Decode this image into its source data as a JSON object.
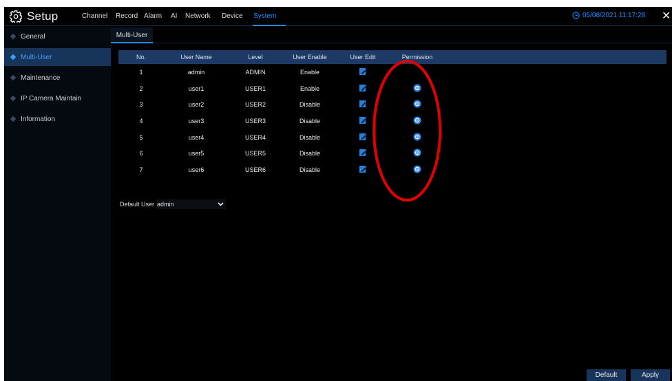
{
  "header": {
    "app_title": "Setup",
    "nav": [
      "Channel",
      "Record",
      "Alarm",
      "AI",
      "Network",
      "Device",
      "System"
    ],
    "active_nav": "System",
    "datetime": "05/08/2021 11:17:28"
  },
  "sidebar": {
    "items": [
      {
        "label": "General"
      },
      {
        "label": "Multi-User"
      },
      {
        "label": "Maintenance"
      },
      {
        "label": "IP Camera Maintain"
      },
      {
        "label": "Information"
      }
    ]
  },
  "subtabs": {
    "active": "Multi-User"
  },
  "table": {
    "headers": [
      "No.",
      "User Name",
      "Level",
      "User Enable",
      "User Edit",
      "Permission"
    ],
    "rows": [
      {
        "no": "1",
        "name": "admin",
        "level": "ADMIN",
        "enable": "Enable",
        "permission": false
      },
      {
        "no": "2",
        "name": "user1",
        "level": "USER1",
        "enable": "Enable",
        "permission": true
      },
      {
        "no": "3",
        "name": "user2",
        "level": "USER2",
        "enable": "Disable",
        "permission": true
      },
      {
        "no": "4",
        "name": "user3",
        "level": "USER3",
        "enable": "Disable",
        "permission": true
      },
      {
        "no": "5",
        "name": "user4",
        "level": "USER4",
        "enable": "Disable",
        "permission": true
      },
      {
        "no": "6",
        "name": "user5",
        "level": "USER5",
        "enable": "Disable",
        "permission": true
      },
      {
        "no": "7",
        "name": "user6",
        "level": "USER6",
        "enable": "Disable",
        "permission": true
      }
    ]
  },
  "default_user": {
    "label": "Default User",
    "value": "admin"
  },
  "buttons": {
    "default": "Default",
    "apply": "Apply"
  },
  "colors": {
    "accent": "#1d8fff",
    "highlight_bg": "#17355a",
    "annotation": "#e00000"
  },
  "icons": {
    "logo": "gear-icon",
    "clock": "clock-icon",
    "close": "close-icon",
    "edit": "edit-icon",
    "permission": "permission-gear-icon",
    "dropdown": "chevron-down-icon"
  }
}
